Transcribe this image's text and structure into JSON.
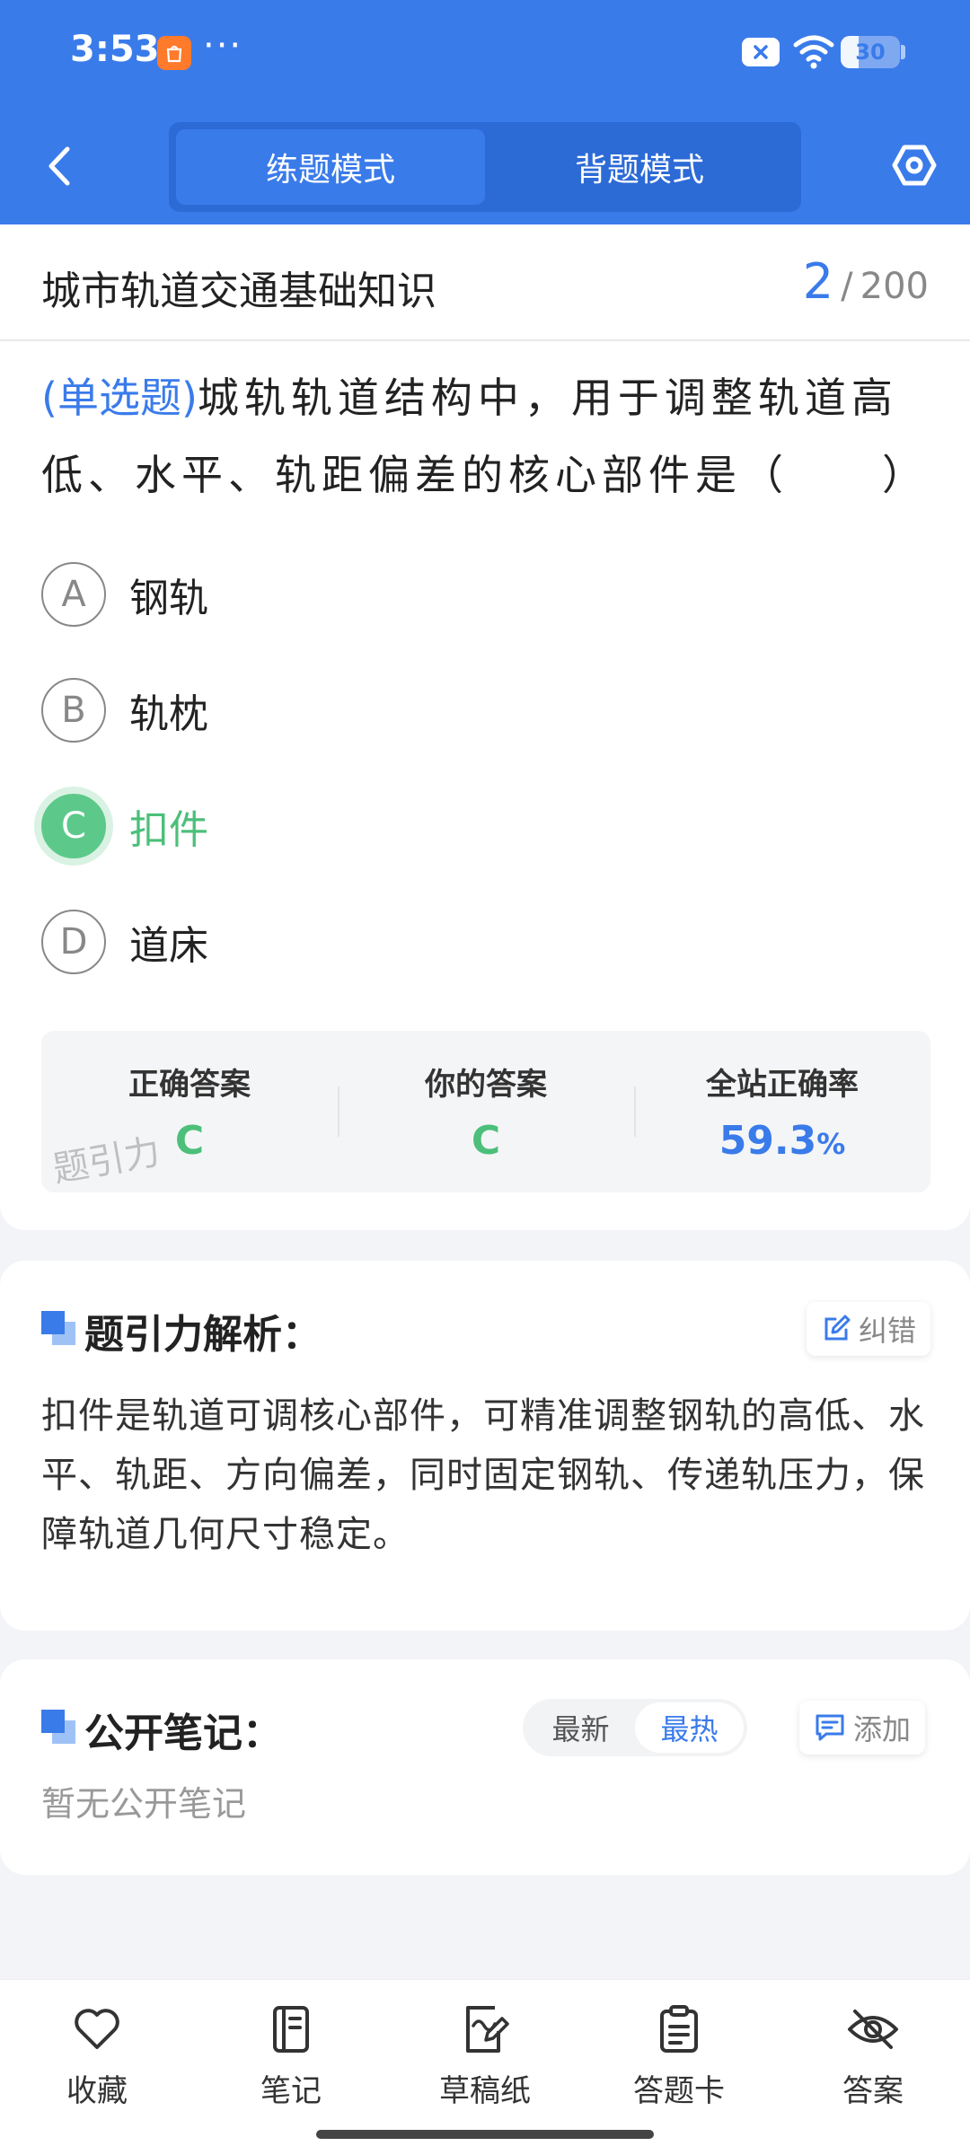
{
  "status_bar": {
    "time": "3:53",
    "dots": "···",
    "battery_level": "30",
    "battery_fraction": 0.3
  },
  "header": {
    "tabs": [
      {
        "label": "练题模式",
        "active": true
      },
      {
        "label": "背题模式",
        "active": false
      }
    ],
    "icons": {
      "back": "chevron-left-icon",
      "settings": "hexagon-settings-icon"
    }
  },
  "question_header": {
    "subject": "城市轨道交通基础知识",
    "current": "2",
    "separator": "/",
    "total": "200"
  },
  "question": {
    "type": "(单选题)",
    "text": "城轨轨道结构中，用于调整轨道高低、水平、轨距偏差的核心部件是（　　）",
    "options": [
      {
        "letter": "A",
        "text": "钢轨"
      },
      {
        "letter": "B",
        "text": "轨枕"
      },
      {
        "letter": "C",
        "text": "扣件"
      },
      {
        "letter": "D",
        "text": "道床"
      }
    ],
    "correct_letter": "C"
  },
  "answer_box": {
    "correct_label": "正确答案",
    "correct_value": "C",
    "yours_label": "你的答案",
    "yours_value": "C",
    "rate_label": "全站正确率",
    "rate_value": "59.3",
    "rate_unit": "%",
    "watermark": "题引力"
  },
  "analysis": {
    "title": "题引力解析：",
    "report_button": "纠错",
    "text": "扣件是轨道可调核心部件，可精准调整钢轨的高低、水平、轨距、方向偏差，同时固定钢轨、传递轨压力，保障轨道几何尺寸稳定。"
  },
  "notes": {
    "title": "公开笔记：",
    "sort_latest": "最新",
    "sort_hot": "最热",
    "add_button": "添加",
    "empty": "暂无公开笔记"
  },
  "bottom_bar": {
    "favorite": "收藏",
    "notes": "笔记",
    "scratch": "草稿纸",
    "answer_card": "答题卡",
    "answer": "答案"
  },
  "colors": {
    "primary": "#3a7bea",
    "correct": "#4cbf7a",
    "background": "#f2f4f7"
  }
}
